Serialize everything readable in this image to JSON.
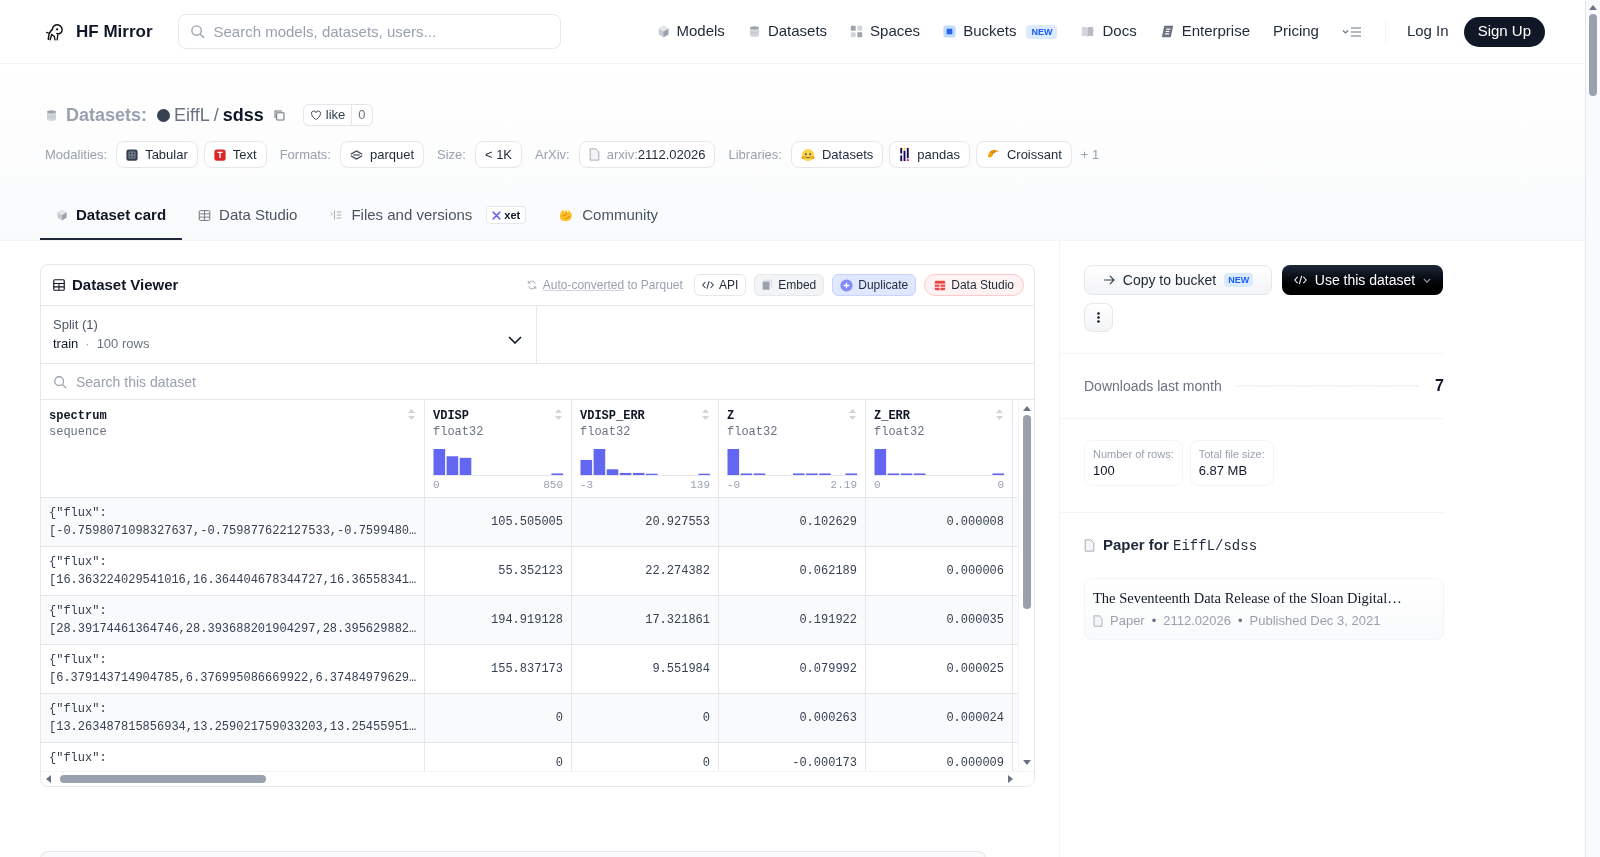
{
  "header": {
    "brand": "HF Mirror",
    "search": {
      "placeholder": "Search models, datasets, users..."
    },
    "nav": [
      {
        "label": "Models"
      },
      {
        "label": "Datasets"
      },
      {
        "label": "Spaces"
      },
      {
        "label": "Buckets",
        "badge": "NEW"
      },
      {
        "label": "Docs"
      },
      {
        "label": "Enterprise"
      },
      {
        "label": "Pricing"
      }
    ],
    "login": "Log In",
    "signup": "Sign Up"
  },
  "dataset": {
    "type_label": "Datasets:",
    "owner": "EiffL",
    "separator": "/",
    "name": "sdss",
    "like": {
      "label": "like",
      "count": "0"
    },
    "tag_groups": [
      {
        "label": "Modalities:",
        "tags": [
          {
            "text": "Tabular"
          },
          {
            "text": "Text"
          }
        ]
      },
      {
        "label": "Formats:",
        "tags": [
          {
            "text": "parquet"
          }
        ]
      },
      {
        "label": "Size:",
        "tags": [
          {
            "text": "< 1K"
          }
        ]
      },
      {
        "label": "ArXiv:",
        "tags": [
          {
            "prefix": "arxiv:",
            "text": "2112.02026"
          }
        ]
      },
      {
        "label": "Libraries:",
        "tags": [
          {
            "text": "Datasets"
          },
          {
            "text": "pandas"
          },
          {
            "text": "Croissant"
          }
        ],
        "more": "+ 1"
      }
    ]
  },
  "tabs": [
    {
      "label": "Dataset card",
      "selected": true
    },
    {
      "label": "Data Studio",
      "selected": false
    },
    {
      "label": "Files and versions",
      "selected": false,
      "badge": "xet"
    },
    {
      "label": "Community",
      "selected": false
    }
  ],
  "viewer": {
    "title": "Dataset Viewer",
    "conversion": {
      "link": "Auto-converted",
      "text": "to Parquet"
    },
    "actions": [
      {
        "label": "API",
        "kind": "api"
      },
      {
        "label": "Embed",
        "kind": "embed"
      },
      {
        "label": "Duplicate",
        "kind": "duplicate"
      },
      {
        "label": "Data Studio",
        "kind": "studio"
      }
    ],
    "split": {
      "label": "Split (1)",
      "value": "train",
      "separator": "·",
      "rows": "100 rows"
    },
    "search": {
      "placeholder": "Search this dataset"
    },
    "columns": [
      {
        "name": "spectrum",
        "type": "sequence"
      },
      {
        "name": "VDISP",
        "type": "float32",
        "min": "0",
        "max": "850"
      },
      {
        "name": "VDISP_ERR",
        "type": "float32",
        "min": "-3",
        "max": "139"
      },
      {
        "name": "Z",
        "type": "float32",
        "min": "-0",
        "max": "2.19"
      },
      {
        "name": "Z_ERR",
        "type": "float32",
        "min": "0",
        "max": "0"
      }
    ],
    "rows": [
      {
        "spectrum": [
          "{\"flux\":",
          "[-0.7598071098327637,-0.759877622127533,-0.7599480…"
        ],
        "values": [
          "105.505005",
          "20.927553",
          "0.102629",
          "0.000008"
        ]
      },
      {
        "spectrum": [
          "{\"flux\":",
          "[16.363224029541016,16.364404678344727,16.36558341…"
        ],
        "values": [
          "55.352123",
          "22.274382",
          "0.062189",
          "0.000006"
        ]
      },
      {
        "spectrum": [
          "{\"flux\":",
          "[28.39174461364746,28.393688201904297,28.395629882…"
        ],
        "values": [
          "194.919128",
          "17.321861",
          "0.191922",
          "0.000035"
        ]
      },
      {
        "spectrum": [
          "{\"flux\":",
          "[6.379143714904785,6.376995086669922,6.37484979629…"
        ],
        "values": [
          "155.837173",
          "9.551984",
          "0.079992",
          "0.000025"
        ]
      },
      {
        "spectrum": [
          "{\"flux\":",
          "[13.263487815856934,13.259021759033203,13.25455951…"
        ],
        "values": [
          "0",
          "0",
          "0.000263",
          "0.000024"
        ]
      },
      {
        "spectrum": [
          "{\"flux\":"
        ],
        "values": [
          "0",
          "0",
          "-0.000173",
          "0.000009"
        ]
      }
    ]
  },
  "sidebar": {
    "copy_button": {
      "label": "Copy to bucket",
      "badge": "NEW"
    },
    "use_button": "Use this dataset",
    "downloads": {
      "label": "Downloads last month",
      "value": "7"
    },
    "stats": [
      {
        "label": "Number of rows:",
        "value": "100"
      },
      {
        "label": "Total file size:",
        "value": "6.87 MB"
      }
    ],
    "paper": {
      "title": "Paper for",
      "repo": "EiffL/sdss",
      "card": {
        "title": "The Seventeenth Data Release of the Sloan Digital…",
        "meta": [
          {
            "text": "Paper"
          },
          {
            "separator": "•",
            "text": "2112.02026"
          },
          {
            "separator": "•",
            "text": "Published Dec 3, 2021"
          }
        ]
      }
    }
  }
}
